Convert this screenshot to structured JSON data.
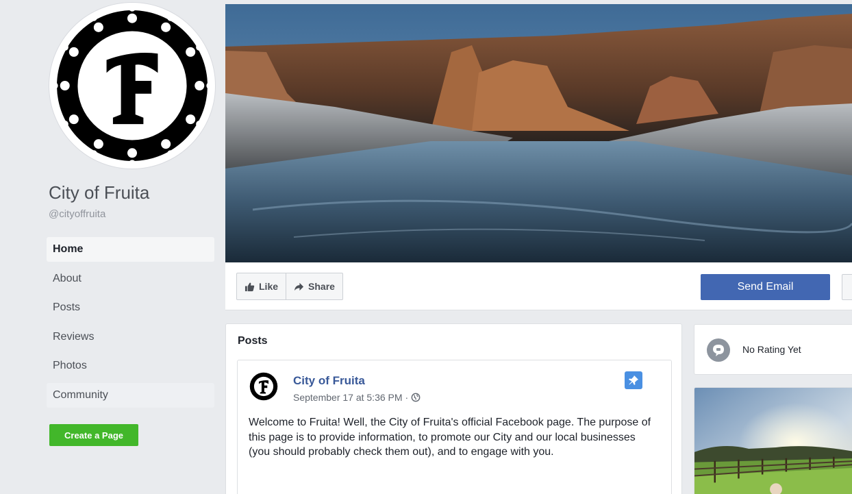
{
  "page": {
    "name": "City of Fruita",
    "handle": "@cityoffruita"
  },
  "left_nav": {
    "items": [
      {
        "label": "Home",
        "active": true
      },
      {
        "label": "About"
      },
      {
        "label": "Posts"
      },
      {
        "label": "Reviews"
      },
      {
        "label": "Photos"
      },
      {
        "label": "Community"
      }
    ],
    "create_page_label": "Create a Page"
  },
  "action_bar": {
    "like_label": "Like",
    "share_label": "Share",
    "send_email_label": "Send Email"
  },
  "posts_section": {
    "heading": "Posts",
    "post": {
      "author": "City of Fruita",
      "timestamp": "September 17 at 5:36 PM",
      "separator": "·",
      "text": "Welcome to Fruita! Well, the City of Fruita's official Facebook page. The purpose of this page is to provide information, to promote our City and our local businesses (you should probably check them out), and to engage with you."
    }
  },
  "rating": {
    "text": "No Rating Yet"
  },
  "colors": {
    "facebook_blue": "#4267b2",
    "link_blue": "#385898",
    "create_green": "#42b72a",
    "pin_blue": "#4a90e2"
  },
  "icons": {
    "like": "thumbs-up-icon",
    "share": "share-arrow-icon",
    "audience": "globe-icon",
    "pin": "pin-icon",
    "rating": "speech-bubble-icon"
  }
}
